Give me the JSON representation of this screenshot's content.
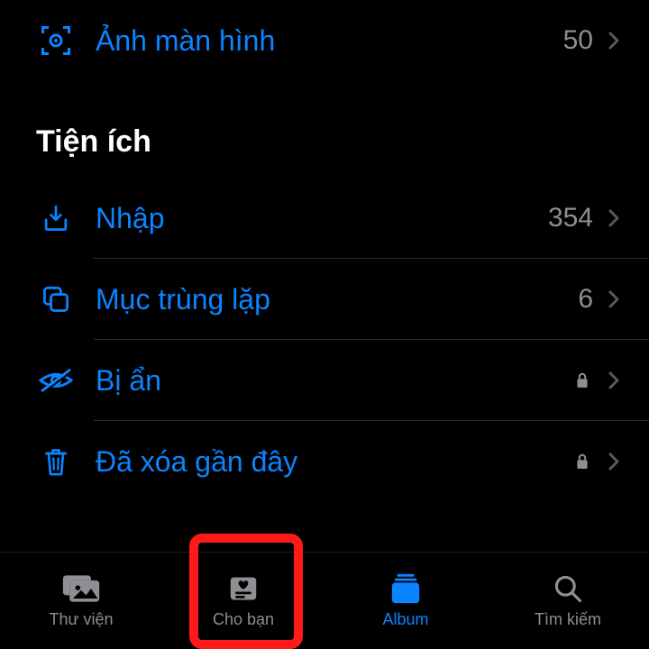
{
  "media_types": {
    "screenshots": {
      "label": "Ảnh màn hình",
      "count": "50"
    }
  },
  "utilities": {
    "title": "Tiện ích",
    "imports": {
      "label": "Nhập",
      "count": "354"
    },
    "duplicates": {
      "label": "Mục trùng lặp",
      "count": "6"
    },
    "hidden": {
      "label": "Bị ẩn"
    },
    "deleted": {
      "label": "Đã xóa gần đây"
    }
  },
  "tabs": {
    "library": "Thư viện",
    "foryou": "Cho bạn",
    "albums": "Album",
    "search": "Tìm kiếm"
  },
  "colors": {
    "accent": "#0a84ff",
    "inactive": "#8e8e93",
    "highlight": "#ff1a1a"
  }
}
